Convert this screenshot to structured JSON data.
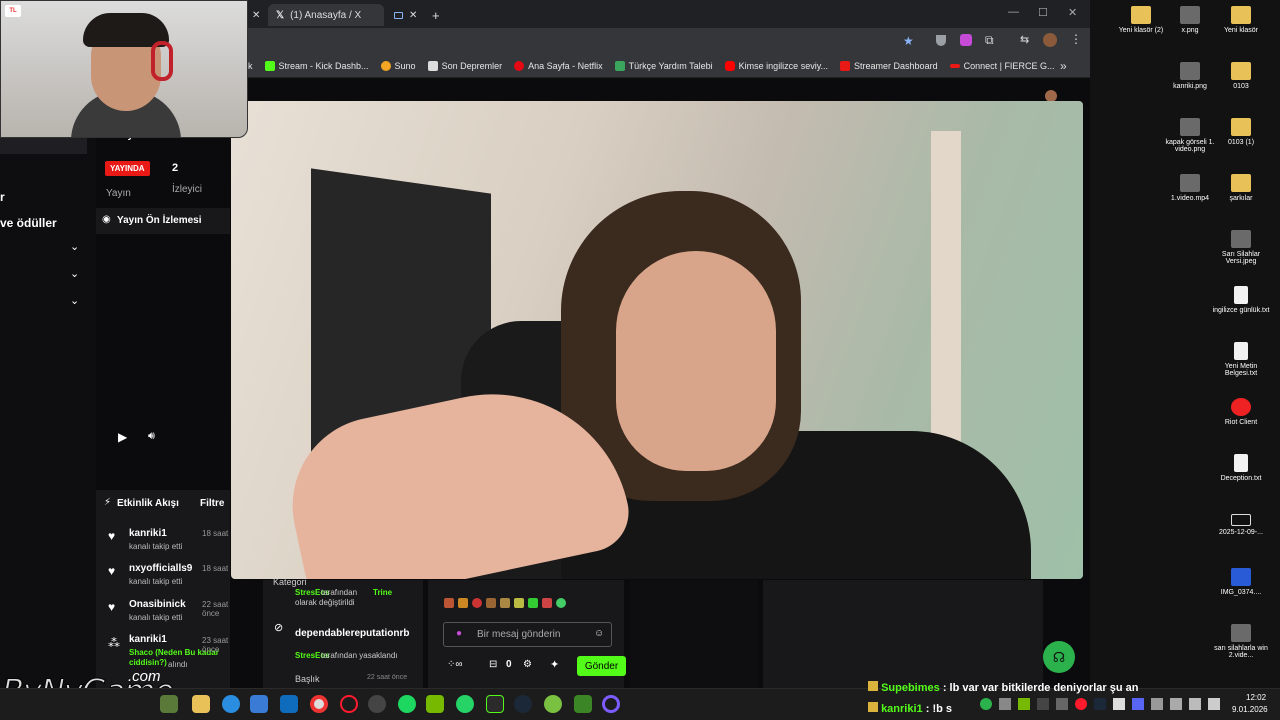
{
  "browser": {
    "tabs": [
      {
        "label": "(1) Anasayfa / X"
      }
    ],
    "new_tab": "+",
    "window_controls": {
      "minimize": "—",
      "maximize": "☐",
      "close": "✕"
    },
    "bookmarks": [
      {
        "label": "k",
        "color": "#888888"
      },
      {
        "label": "Stream - Kick Dashb...",
        "color": "#53fc18"
      },
      {
        "label": "Suno",
        "color": "#f5a623"
      },
      {
        "label": "Son Depremler",
        "color": "#dddddd"
      },
      {
        "label": "Ana Sayfa - Netflix",
        "color": "#e50914"
      },
      {
        "label": "Türkçe Yardım Talebi",
        "color": "#3aa55d"
      },
      {
        "label": "Kimse ingilizce seviy...",
        "color": "#ff0000"
      },
      {
        "label": "Streamer Dashboard",
        "color": "#e91916"
      },
      {
        "label": "Connect | FIERCE G...",
        "color": "#e91916"
      }
    ],
    "more": "»"
  },
  "leftnav": {
    "item1": "r",
    "item2": "ve ödüller"
  },
  "stats": {
    "header": "Yayın İstatistikleri",
    "live_badge": "YAYINDA",
    "status_label": "Yayın",
    "viewers": "2",
    "viewers_label": "İzleyici",
    "preview_title": "Yayın Ön İzlemesi"
  },
  "activity": {
    "title": "Etkinlik Akışı",
    "filter": "Filtre",
    "items": [
      {
        "name": "kanriki1",
        "sub": "kanalı takip etti",
        "time": "18 saat"
      },
      {
        "name": "nxyofficialls9",
        "sub": "kanalı takip etti",
        "time": "18 saat"
      },
      {
        "name": "Onasibinick",
        "sub": "kanalı takip etti",
        "time": "22 saat önce"
      },
      {
        "name": "kanriki1",
        "sub": "alındı",
        "reward": "Shaco (Neden Bu kadar ciddisin?)",
        "time": "23 saat önce"
      }
    ]
  },
  "modlog": {
    "row1_title": "Kategori",
    "row1_user": "StresEos",
    "row1_text": "tarafından",
    "row1_value": "Trine",
    "row1_text2": "olarak değiştirildi",
    "row2_title": "dependablereputationrb",
    "row2_user": "StresEos",
    "row2_text": "tarafından yasaklandı",
    "row3_title": "Başlık",
    "row3_time": "22 saat önce"
  },
  "chat": {
    "placeholder": "Bir mesaj gönderin",
    "count": "0",
    "send": "Gönder",
    "overlay1_user": "Supebimes",
    "overlay1_text": ": lb var var bitkilerde deniyorlar şu an",
    "overlay2_user": "kanriki1",
    "overlay2_text": ": !b s"
  },
  "watermark": "ByNvGame",
  "watermark2": ".com",
  "desktop": {
    "icons": [
      {
        "label": "Yeni klasör (2)",
        "type": "folder"
      },
      {
        "label": "x.png",
        "type": "img"
      },
      {
        "label": "Yeni klasör",
        "type": "folder"
      },
      {
        "label": "kanriki.png",
        "type": "img"
      },
      {
        "label": "0103",
        "type": "folder"
      },
      {
        "label": "kapak görseli 1. video.png",
        "type": "img"
      },
      {
        "label": "0103 (1)",
        "type": "folder"
      },
      {
        "label": "1.video.mp4",
        "type": "img"
      },
      {
        "label": "şarkılar",
        "type": "folder"
      },
      {
        "label": "Sarı Silahlar Versi.jpeg",
        "type": "img"
      },
      {
        "label": "ingilizce günlük.txt",
        "type": "file"
      },
      {
        "label": "Yeni Metin Belgesi.txt",
        "type": "file"
      },
      {
        "label": "Riot Client",
        "type": "riot"
      },
      {
        "label": "Deception.txt",
        "type": "file"
      },
      {
        "label": "2025-12-09-...",
        "type": "file"
      },
      {
        "label": "IMG_0374....",
        "type": "img"
      },
      {
        "label": "sarı silahlarla win 2.vide...",
        "type": "img"
      }
    ]
  },
  "taskbar": {
    "time": "12:02",
    "date": "9.01.2026"
  },
  "colors": {
    "kick_green": "#53fc18",
    "live_red": "#e91916",
    "page_bg": "#0b0b0d"
  }
}
